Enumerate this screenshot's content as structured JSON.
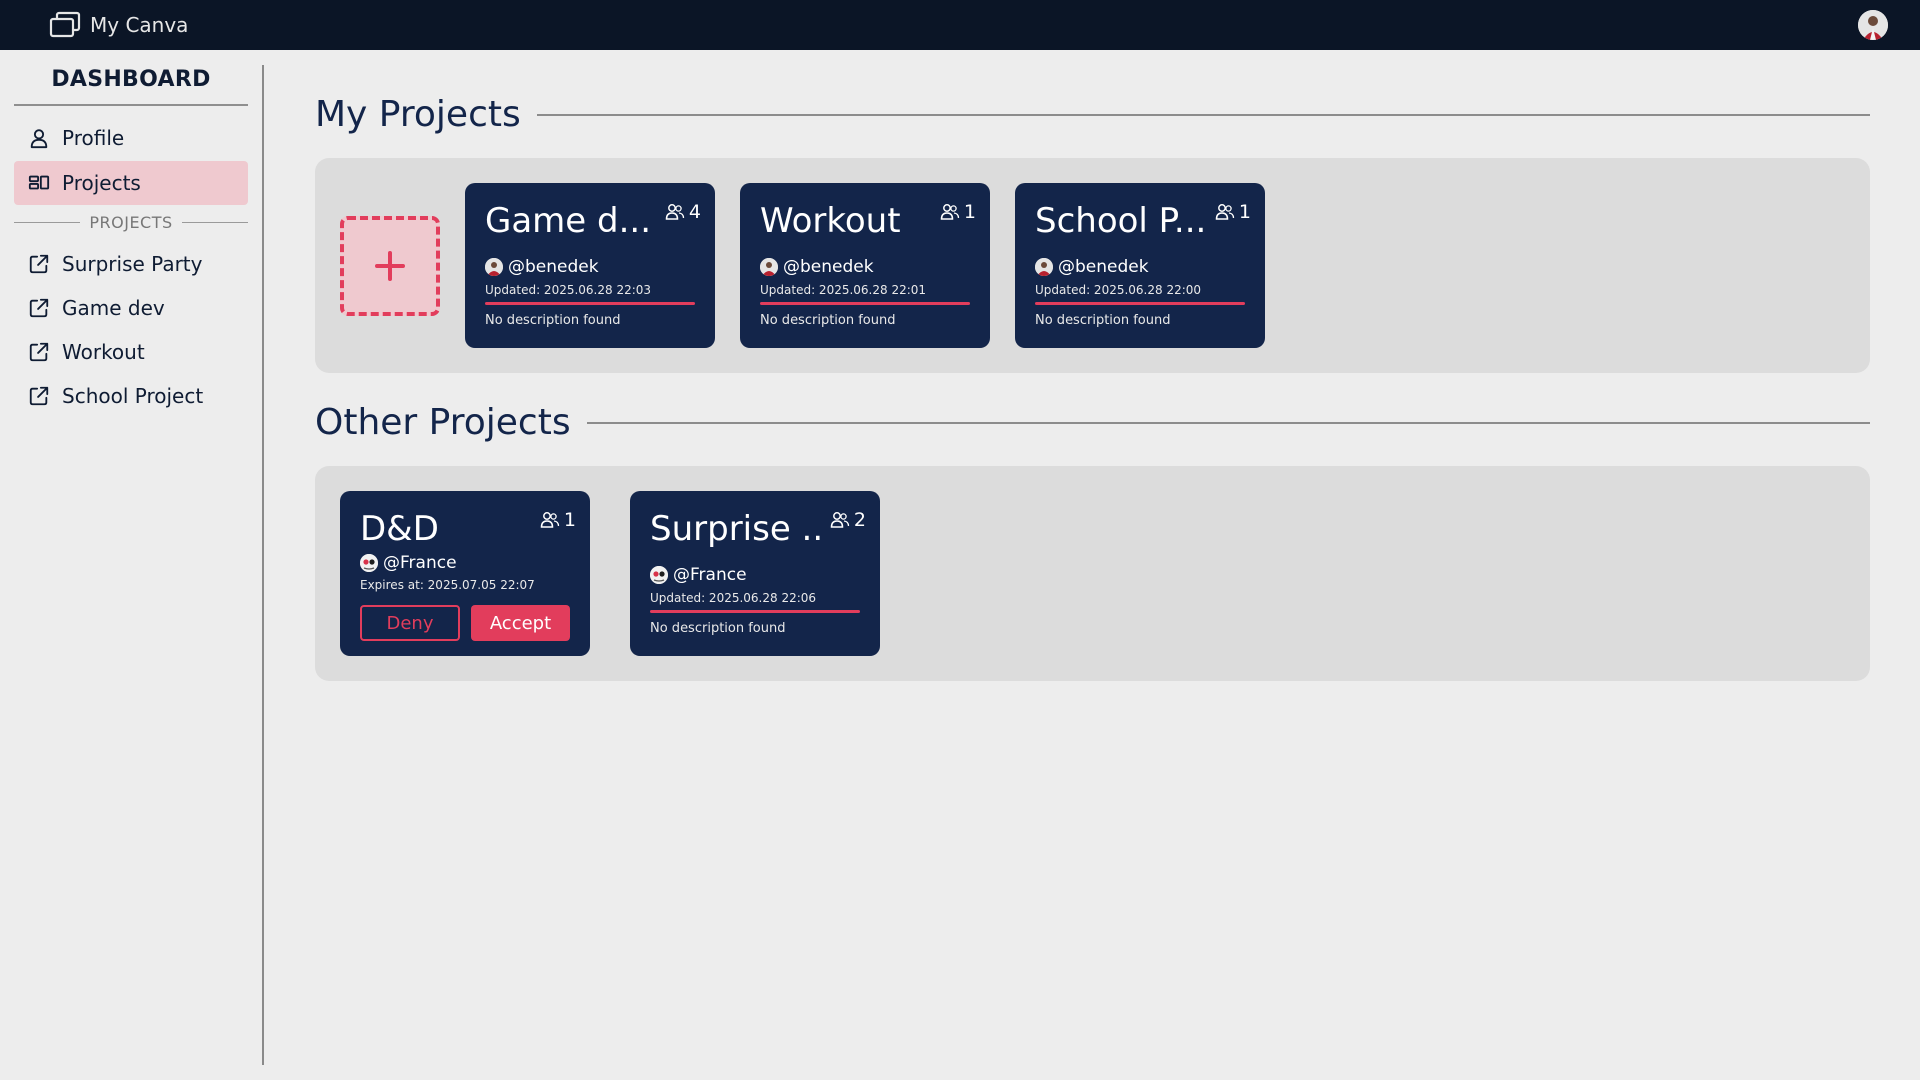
{
  "app": {
    "title": "My Canva"
  },
  "sidebar": {
    "title": "DASHBOARD",
    "nav": [
      {
        "label": "Profile",
        "icon": "user-icon"
      },
      {
        "label": "Projects",
        "icon": "projects-icon",
        "active": true
      }
    ],
    "section_label": "PROJECTS",
    "projects": [
      {
        "label": "Surprise Party",
        "icon": "external-link-icon"
      },
      {
        "label": "Game dev",
        "icon": "external-link-icon"
      },
      {
        "label": "Workout",
        "icon": "external-link-icon"
      },
      {
        "label": "School Project",
        "icon": "external-link-icon"
      }
    ]
  },
  "my_projects": {
    "title": "My Projects",
    "add_icon": "plus-icon",
    "cards": [
      {
        "title": "Game d...",
        "members": "4",
        "owner": "@benedek",
        "updated": "Updated: 2025.06.28 22:03",
        "description": "No description found"
      },
      {
        "title": "Workout",
        "members": "1",
        "owner": "@benedek",
        "updated": "Updated: 2025.06.28 22:01",
        "description": "No description found"
      },
      {
        "title": "School P...",
        "members": "1",
        "owner": "@benedek",
        "updated": "Updated: 2025.06.28 22:00",
        "description": "No description found"
      }
    ]
  },
  "other_projects": {
    "title": "Other Projects",
    "invite": {
      "title": "D&D",
      "members": "1",
      "owner": "@France",
      "expires": "Expires at: 2025.07.05 22:07",
      "deny_label": "Deny",
      "accept_label": "Accept"
    },
    "cards": [
      {
        "title": "Surprise ...",
        "members": "2",
        "owner": "@France",
        "updated": "Updated: 2025.06.28 22:06",
        "description": "No description found"
      }
    ]
  },
  "colors": {
    "accent": "#e23d5c",
    "card": "#13254a",
    "topbar": "#0b1526",
    "background": "#ededed",
    "panel": "#dcdcdc"
  }
}
